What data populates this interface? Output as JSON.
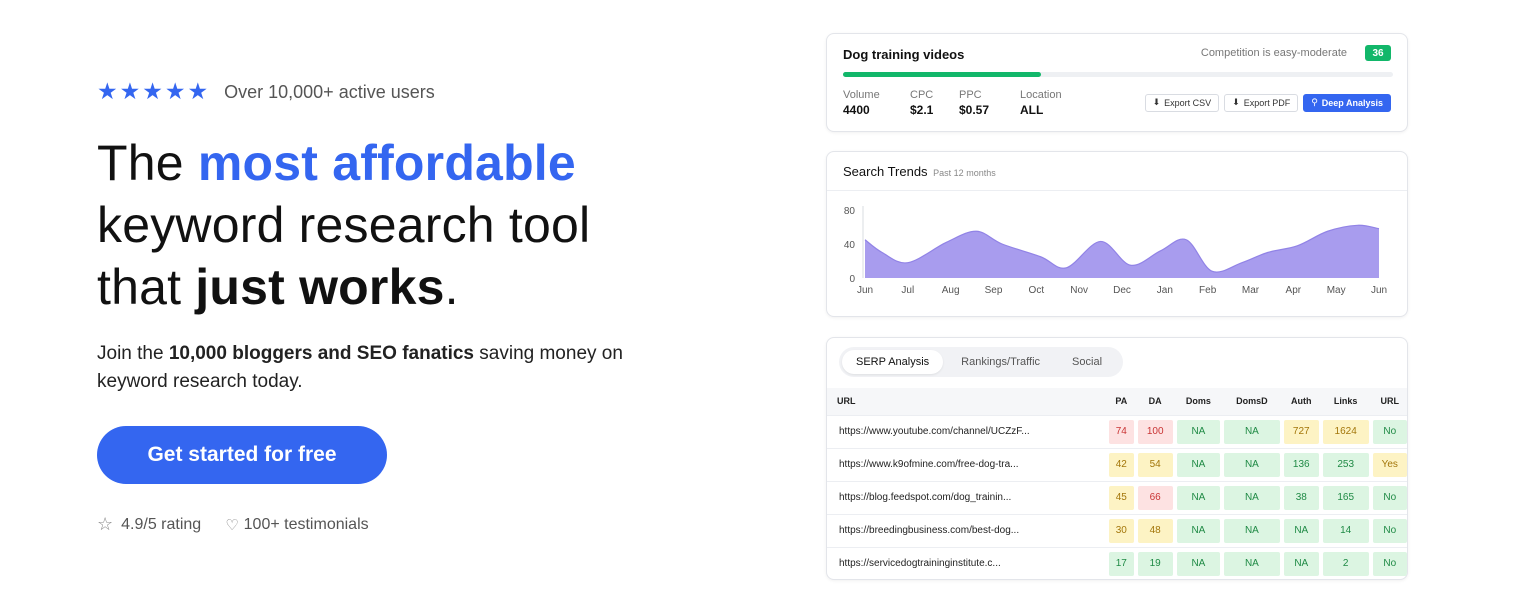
{
  "hero": {
    "rating_users": "Over 10,000+ active users",
    "headline": {
      "prefix": "The ",
      "accent": "most affordable",
      "line2": "keyword research tool",
      "line3_prefix": "that ",
      "line3_strong": "just works",
      "line3_suffix": "."
    },
    "sub": {
      "prefix": "Join the ",
      "strong": "10,000 bloggers and SEO fanatics",
      "suffix": " saving money on keyword research today."
    },
    "cta_label": "Get started for free",
    "rating_label": "4.9/5 rating",
    "testimonials_label": "100+ testimonials",
    "stars": 5
  },
  "colors": {
    "accent": "#3466f0",
    "success": "#12b76a"
  },
  "keyword_card": {
    "title": "Dog training videos",
    "competition_label": "Competition is easy-moderate",
    "score": "36",
    "score_fraction": 0.36,
    "metrics": [
      {
        "label": "Volume",
        "value": "4400"
      },
      {
        "label": "CPC",
        "value": "$2.1"
      },
      {
        "label": "PPC",
        "value": "$0.57"
      },
      {
        "label": "Location",
        "value": "ALL"
      }
    ],
    "buttons": {
      "export_csv": "Export CSV",
      "export_pdf": "Export PDF",
      "deep_analysis": "Deep Analysis"
    }
  },
  "trends_card": {
    "title": "Search Trends",
    "subtitle": "Past 12 months"
  },
  "chart_data": {
    "type": "area",
    "title": "Search Trends",
    "subtitle": "Past 12 months",
    "categories": [
      "Jun",
      "Jul",
      "Aug",
      "Sep",
      "Oct",
      "Nov",
      "Dec",
      "Jan",
      "Feb",
      "Mar",
      "Apr",
      "May",
      "Jun"
    ],
    "x_positions": [
      0,
      1,
      2,
      3,
      4,
      5,
      6,
      7,
      8,
      9,
      10,
      11,
      12
    ],
    "x": [
      0,
      0.4,
      1,
      1.9,
      2.6,
      3.2,
      4.1,
      4.7,
      5.5,
      6.2,
      6.9,
      7.5,
      8.1,
      8.8,
      9.4,
      10.1,
      10.8,
      11.5,
      12
    ],
    "values": [
      45,
      30,
      18,
      42,
      55,
      40,
      25,
      12,
      43,
      15,
      32,
      45,
      8,
      18,
      30,
      38,
      55,
      62,
      58
    ],
    "yticks": [
      0,
      40,
      80
    ],
    "ylim": [
      0,
      80
    ],
    "grid": false,
    "color": "#a89cee"
  },
  "serp": {
    "tabs": [
      "SERP Analysis",
      "Rankings/Traffic",
      "Social"
    ],
    "active_tab": 0,
    "columns": [
      "URL",
      "PA",
      "DA",
      "Doms",
      "DomsD",
      "Auth",
      "Links",
      "URL"
    ],
    "rows": [
      {
        "url": "https://www.youtube.com/channel/UCZzF...",
        "cells": [
          [
            "74",
            "red"
          ],
          [
            "100",
            "red"
          ],
          [
            "NA",
            "grn"
          ],
          [
            "NA",
            "grn"
          ],
          [
            "727",
            "yel"
          ],
          [
            "1624",
            "yel"
          ],
          [
            "No",
            "grn"
          ]
        ]
      },
      {
        "url": "https://www.k9ofmine.com/free-dog-tra...",
        "cells": [
          [
            "42",
            "yel"
          ],
          [
            "54",
            "yel"
          ],
          [
            "NA",
            "grn"
          ],
          [
            "NA",
            "grn"
          ],
          [
            "136",
            "grn"
          ],
          [
            "253",
            "grn"
          ],
          [
            "Yes",
            "yel"
          ]
        ]
      },
      {
        "url": "https://blog.feedspot.com/dog_trainin...",
        "cells": [
          [
            "45",
            "yel"
          ],
          [
            "66",
            "red"
          ],
          [
            "NA",
            "grn"
          ],
          [
            "NA",
            "grn"
          ],
          [
            "38",
            "grn"
          ],
          [
            "165",
            "grn"
          ],
          [
            "No",
            "grn"
          ]
        ]
      },
      {
        "url": "https://breedingbusiness.com/best-dog...",
        "cells": [
          [
            "30",
            "yel"
          ],
          [
            "48",
            "yel"
          ],
          [
            "NA",
            "grn"
          ],
          [
            "NA",
            "grn"
          ],
          [
            "NA",
            "grn"
          ],
          [
            "14",
            "grn"
          ],
          [
            "No",
            "grn"
          ]
        ]
      },
      {
        "url": "https://servicedogtraininginstitute.c...",
        "cells": [
          [
            "17",
            "grn"
          ],
          [
            "19",
            "grn"
          ],
          [
            "NA",
            "grn"
          ],
          [
            "NA",
            "grn"
          ],
          [
            "NA",
            "grn"
          ],
          [
            "2",
            "grn"
          ],
          [
            "No",
            "grn"
          ]
        ]
      }
    ]
  }
}
